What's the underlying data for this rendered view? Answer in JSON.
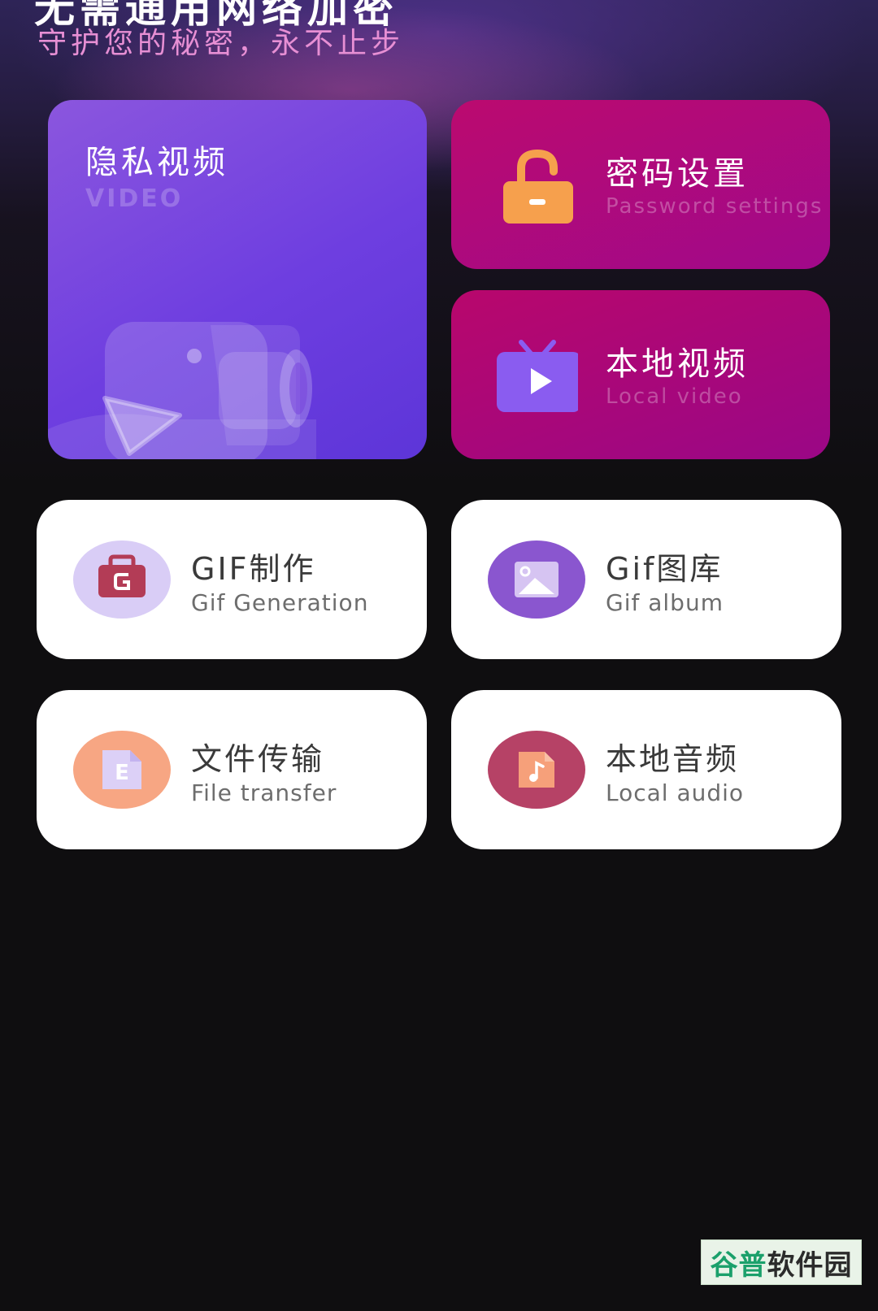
{
  "header": {
    "title": "无需通用网络加密",
    "subtitle": "守护您的秘密，永不止步"
  },
  "featured": {
    "title": "隐私视频",
    "subtitle": "VIDEO",
    "icon": "video-camera-icon"
  },
  "actions": [
    {
      "title": "密码设置",
      "subtitle": "Password settings",
      "icon": "unlock-icon"
    },
    {
      "title": "本地视频",
      "subtitle": "Local video",
      "icon": "tv-play-icon"
    }
  ],
  "tools": [
    {
      "title": "GIF制作",
      "subtitle": "Gif Generation",
      "icon": "gif-bag-icon"
    },
    {
      "title": "Gif图库",
      "subtitle": "Gif album",
      "icon": "image-icon"
    },
    {
      "title": "文件传输",
      "subtitle": "File transfer",
      "icon": "file-icon"
    },
    {
      "title": "本地音频",
      "subtitle": "Local audio",
      "icon": "music-file-icon"
    }
  ],
  "watermark": {
    "part1": "谷普",
    "part2": "软件园"
  },
  "colors": {
    "featured_gradient": "#6e3ee0",
    "pink_card": "#b0087c",
    "subtitle_text": "#e78fd4",
    "lock_orange": "#f6a04d",
    "tv_purple": "#8a5cf0",
    "gif_icon_bg": "#d9cdf6",
    "gif_icon_fg": "#b33c56",
    "album_icon_bg": "#8a56cf",
    "file_icon_bg": "#f7a683",
    "audio_icon_bg": "#b64266"
  }
}
